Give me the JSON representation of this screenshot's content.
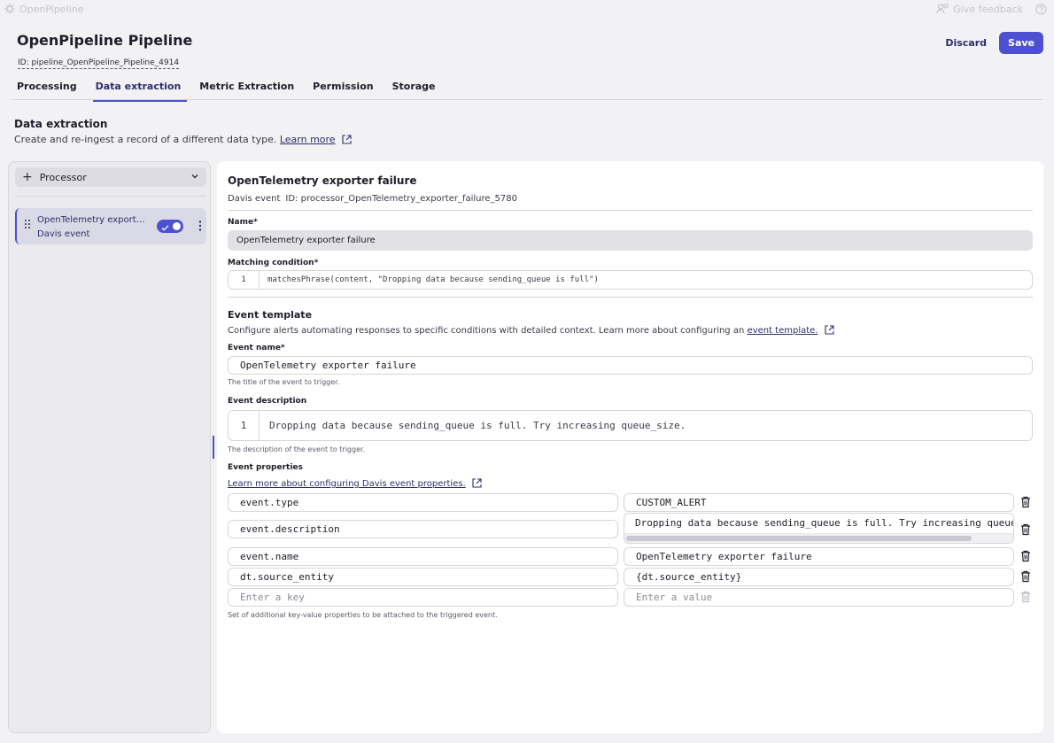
{
  "app": {
    "name": "OpenPipeline",
    "feedback": "Give feedback"
  },
  "header": {
    "title": "OpenPipeline Pipeline",
    "id": "ID: pipeline_OpenPipeline_Pipeline_4914",
    "discard": "Discard",
    "save": "Save"
  },
  "tabs": [
    "Processing",
    "Data extraction",
    "Metric Extraction",
    "Permission",
    "Storage"
  ],
  "section": {
    "title": "Data extraction",
    "desc": "Create and re-ingest a record of a different data type.",
    "learn_more": "Learn more"
  },
  "sidebar": {
    "add_label": "Processor",
    "item": {
      "name": "OpenTelemetry exporter failure",
      "type": "Davis event",
      "enabled": true
    }
  },
  "main": {
    "title": "OpenTelemetry exporter failure",
    "type": "Davis event",
    "id": "ID: processor_OpenTelemetry_exporter_failure_5780",
    "name_label": "Name*",
    "name_value": "OpenTelemetry exporter failure",
    "matching_label": "Matching condition*",
    "matching_line": "1",
    "matching_code": "matchesPhrase(content, \"Dropping data because sending_queue is full\")",
    "template_title": "Event template",
    "template_desc": "Configure alerts automating responses to specific conditions with detailed context. Learn more about configuring an",
    "template_link": "event template.",
    "event_name_label": "Event name*",
    "event_name_value": "OpenTelemetry exporter failure",
    "event_name_hint": "The title of the event to trigger.",
    "event_desc_label": "Event description",
    "event_desc_line": "1",
    "event_desc_value": "Dropping data because sending_queue is full. Try increasing queue_size.",
    "event_desc_hint": "The description of the event to trigger.",
    "props_label": "Event properties",
    "props_link": "Learn more about configuring Davis event properties.",
    "props": [
      {
        "key": "event.type",
        "value": "CUSTOM_ALERT"
      },
      {
        "key": "event.description",
        "value": "Dropping data because sending_queue is full. Try increasing queue_size."
      },
      {
        "key": "event.name",
        "value": "OpenTelemetry exporter failure"
      },
      {
        "key": "dt.source_entity",
        "value": "{dt.source_entity}"
      }
    ],
    "new_key_placeholder": "Enter a key",
    "new_value_placeholder": "Enter a value",
    "props_hint": "Set of additional key-value properties to be attached to the triggered event."
  },
  "colors": {
    "accent": "#4d50d1",
    "link": "#2d2d6e"
  }
}
